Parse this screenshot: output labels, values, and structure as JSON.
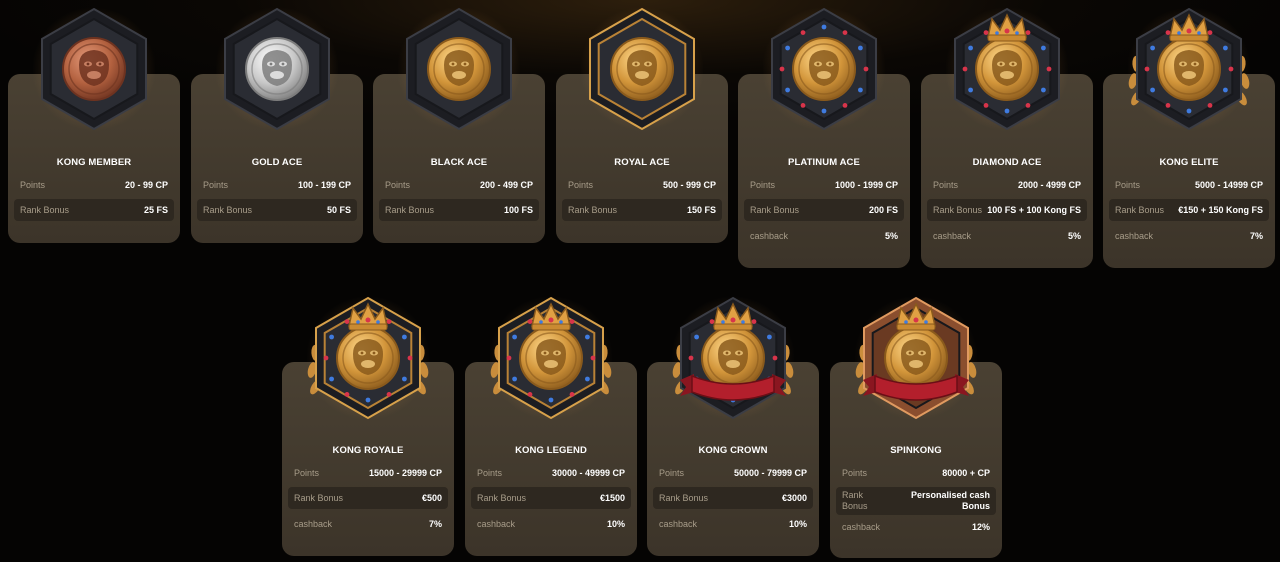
{
  "colors": {
    "card_bg": "#463d30",
    "row_alt": "#2e2820",
    "label": "#a89d8a",
    "value": "#ffffff",
    "bronze": "#b86a4a",
    "silver": "#c9c9c9",
    "gold": "#d39a3a"
  },
  "tiers": [
    {
      "name": "KONG MEMBER",
      "coin": "bronze",
      "frame": "hex-plain",
      "rows": [
        {
          "label": "Points",
          "value": "20 - 99 CP"
        },
        {
          "label": "Rank Bonus",
          "value": "25 FS"
        }
      ]
    },
    {
      "name": "GOLD ACE",
      "coin": "silver",
      "frame": "hex-plain",
      "rows": [
        {
          "label": "Points",
          "value": "100 - 199 CP"
        },
        {
          "label": "Rank Bonus",
          "value": "50 FS"
        }
      ]
    },
    {
      "name": "BLACK ACE",
      "coin": "gold",
      "frame": "hex-plain",
      "rows": [
        {
          "label": "Points",
          "value": "200 - 499 CP"
        },
        {
          "label": "Rank Bonus",
          "value": "100 FS"
        }
      ]
    },
    {
      "name": "ROYAL ACE",
      "coin": "gold",
      "frame": "hex-gold-rim",
      "rows": [
        {
          "label": "Points",
          "value": "500 - 999 CP"
        },
        {
          "label": "Rank Bonus",
          "value": "150 FS"
        }
      ]
    },
    {
      "name": "PLATINUM ACE",
      "coin": "gold",
      "frame": "hex-gems",
      "rows": [
        {
          "label": "Points",
          "value": "1000 - 1999 CP"
        },
        {
          "label": "Rank Bonus",
          "value": "200 FS"
        },
        {
          "label": "cashback",
          "value": "5%"
        }
      ]
    },
    {
      "name": "DIAMOND ACE",
      "coin": "gold",
      "frame": "hex-gems-crown",
      "rows": [
        {
          "label": "Points",
          "value": "2000 - 4999 CP"
        },
        {
          "label": "Rank Bonus",
          "value": "100 FS + 100 Kong FS"
        },
        {
          "label": "cashback",
          "value": "5%"
        }
      ]
    },
    {
      "name": "KONG ELITE",
      "coin": "gold",
      "frame": "hex-gems-crown-laurel",
      "rows": [
        {
          "label": "Points",
          "value": "5000 - 14999 CP"
        },
        {
          "label": "Rank Bonus",
          "value": "€150 + 150 Kong FS"
        },
        {
          "label": "cashback",
          "value": "7%"
        }
      ]
    },
    {
      "name": "KONG ROYALE",
      "coin": "gold",
      "frame": "hex-gems-crown-laurel-gold",
      "rows": [
        {
          "label": "Points",
          "value": "15000 - 29999 CP"
        },
        {
          "label": "Rank Bonus",
          "value": "€500"
        },
        {
          "label": "cashback",
          "value": "7%"
        }
      ]
    },
    {
      "name": "KONG LEGEND",
      "coin": "gold",
      "frame": "hex-gems-crown-laurel-gold",
      "rows": [
        {
          "label": "Points",
          "value": "30000 - 49999 CP"
        },
        {
          "label": "Rank Bonus",
          "value": "€1500"
        },
        {
          "label": "cashback",
          "value": "10%"
        }
      ]
    },
    {
      "name": "KONG CROWN",
      "coin": "gold",
      "frame": "hex-gems-crown-laurel-ribbon",
      "rows": [
        {
          "label": "Points",
          "value": "50000 - 79999 CP"
        },
        {
          "label": "Rank Bonus",
          "value": "€3000"
        },
        {
          "label": "cashback",
          "value": "10%"
        }
      ]
    },
    {
      "name": "SPINKONG",
      "coin": "gold",
      "frame": "hex-bronze-crown-laurel-ribbon",
      "rows": [
        {
          "label": "Points",
          "value": "80000 + CP"
        },
        {
          "label_line1": "Rank",
          "label_line2": "Bonus",
          "value_line1": "Personalised cash",
          "value_line2": "Bonus"
        },
        {
          "label": "cashback",
          "value": "12%"
        }
      ]
    }
  ]
}
